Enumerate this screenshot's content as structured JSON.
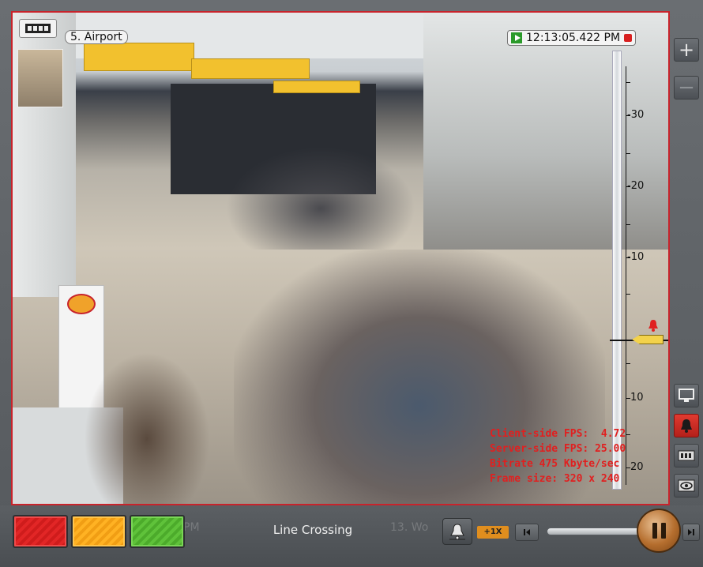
{
  "camera": {
    "title": "5. Airport",
    "timestamp": "12:13:05.422 PM",
    "stats": {
      "client_fps": "Client-side FPS:  4.72",
      "server_fps": "Server-side FPS: 25.00",
      "bitrate": "Bitrate 475 Kbyte/sec",
      "frame_size": "Frame size: 320 x 240"
    }
  },
  "sensitivity_scale": {
    "labels": [
      "-30",
      "-20",
      "-10",
      "10",
      "20"
    ],
    "threshold_value": 0
  },
  "side_buttons": {
    "zoom_in": "+",
    "zoom_out": "−"
  },
  "bottom_bar": {
    "event_label": "Line Crossing",
    "speed_badge": "+1X",
    "ghost_left": "PM",
    "ghost_right": "13. Wo"
  },
  "colors": {
    "active_border": "#c8232b",
    "stats_text": "#e02020",
    "alarm_button": "#e13a30",
    "threshold_handle": "#f3d24b"
  },
  "icons": [
    "archive-icon",
    "play-icon",
    "record-icon",
    "alarm-bell-icon",
    "monitor-icon",
    "eye-icon",
    "step-back-icon",
    "pause-icon",
    "step-forward-icon"
  ]
}
